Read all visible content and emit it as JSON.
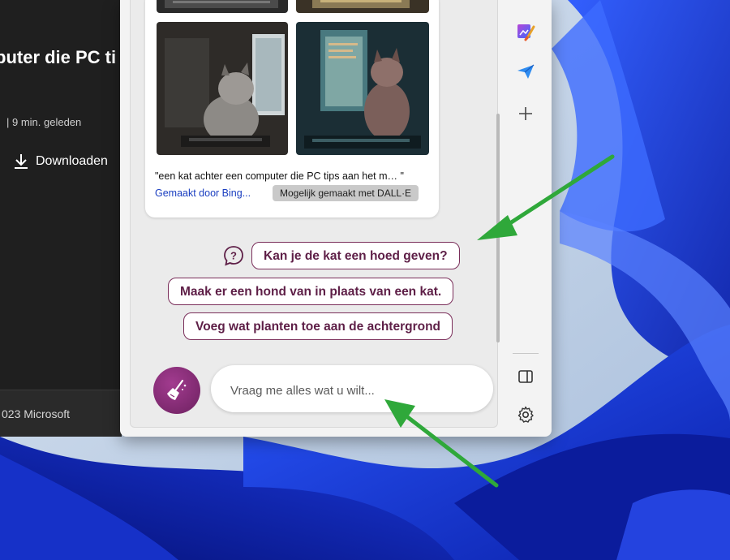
{
  "left_app": {
    "title": "puter die PC ti",
    "meta": "|  9 min. geleden",
    "download_label": "Downloaden",
    "footer": "023 Microsoft"
  },
  "chat": {
    "image_caption": "\"een kat achter een computer die PC tips aan het m… \"",
    "made_by": "Gemaakt door Bing...",
    "dalle_label": "Mogelijk gemaakt met DALL·E",
    "suggestions": [
      "Kan je de kat een hoed geven?",
      "Maak er een hond van in plaats van een kat.",
      "Voeg wat planten toe aan de achtergrond"
    ],
    "input_placeholder": "Vraag me alles wat u wilt..."
  },
  "sidebar": {
    "icons": [
      "designer-icon",
      "send-icon",
      "plus-icon",
      "sidebar-toggle-icon",
      "settings-icon"
    ]
  },
  "colors": {
    "accent": "#7a2e5a",
    "arrow": "#2fa83a",
    "link": "#1a3ec0"
  }
}
